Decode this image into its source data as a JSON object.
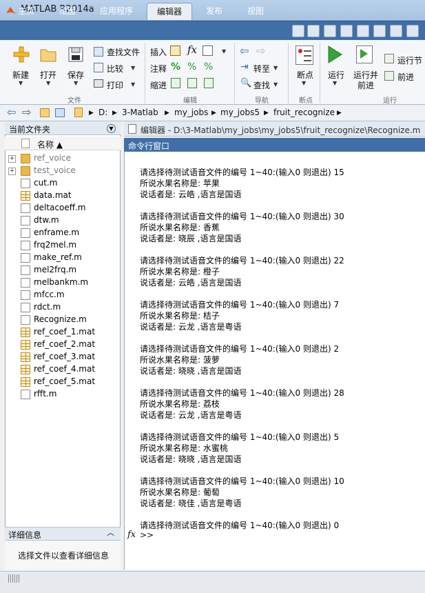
{
  "window": {
    "title": "MATLAB R2014a"
  },
  "tabs": [
    "主页",
    "绘图",
    "应用程序",
    "编辑器",
    "发布",
    "视图"
  ],
  "ribbon": {
    "file_group": {
      "new": "新建",
      "open": "打开",
      "save": "保存",
      "find_files": "查找文件",
      "compare": "比较",
      "print": "打印",
      "label": "文件"
    },
    "edit_group": {
      "insert": "插入",
      "comment": "注释",
      "indent": "缩进",
      "label": "编辑"
    },
    "nav_group": {
      "goto": "转至",
      "find": "查找",
      "label": "导航"
    },
    "breakpoint_group": {
      "breakpoints": "断点",
      "label": "断点"
    },
    "run_group": {
      "run": "运行",
      "run_advance_line1": "运行并",
      "run_advance_line2": "前进",
      "run_section": "运行节",
      "advance": "前进",
      "label": "运行"
    }
  },
  "address": {
    "crumbs": [
      "D:",
      "3-Matlab",
      "my_jobs",
      "my_jobs5",
      "fruit_recognize"
    ]
  },
  "left_panel": {
    "title": "当前文件夹",
    "column_name": "名称 ▲",
    "files": [
      {
        "name": "ref_voice",
        "type": "folder"
      },
      {
        "name": "test_voice",
        "type": "folder"
      },
      {
        "name": "cut.m",
        "type": "m"
      },
      {
        "name": "data.mat",
        "type": "mat"
      },
      {
        "name": "deltacoeff.m",
        "type": "m"
      },
      {
        "name": "dtw.m",
        "type": "m"
      },
      {
        "name": "enframe.m",
        "type": "m"
      },
      {
        "name": "frq2mel.m",
        "type": "m"
      },
      {
        "name": "make_ref.m",
        "type": "m"
      },
      {
        "name": "mel2frq.m",
        "type": "m"
      },
      {
        "name": "melbankm.m",
        "type": "m"
      },
      {
        "name": "mfcc.m",
        "type": "m"
      },
      {
        "name": "rdct.m",
        "type": "m"
      },
      {
        "name": "Recognize.m",
        "type": "m"
      },
      {
        "name": "ref_coef_1.mat",
        "type": "mat"
      },
      {
        "name": "ref_coef_2.mat",
        "type": "mat"
      },
      {
        "name": "ref_coef_3.mat",
        "type": "mat"
      },
      {
        "name": "ref_coef_4.mat",
        "type": "mat"
      },
      {
        "name": "ref_coef_5.mat",
        "type": "mat"
      },
      {
        "name": "rfft.m",
        "type": "m"
      }
    ],
    "details_title": "详细信息",
    "details_text": "选择文件以查看详细信息"
  },
  "editor": {
    "tab_title": "编辑器 - D:\\3-Matlab\\my_jobs\\my_jobs5\\fruit_recognize\\Recognize.m"
  },
  "command_window": {
    "title": "命令行窗口",
    "lines": [
      "请选择待测试语音文件的编号 1~40:(输入0 则退出) 15",
      "所说水果名称是: 苹果",
      "说话者是: 云皓 ,语言是国语",
      "请选择待测试语音文件的编号 1~40:(输入0 则退出) 30",
      "所说水果名称是: 香蕉",
      "说话者是: 晓辰 ,语言是国语",
      "请选择待测试语音文件的编号 1~40:(输入0 则退出) 22",
      "所说水果名称是: 橙子",
      "说话者是: 云皓 ,语言是国语",
      "请选择待测试语音文件的编号 1~40:(输入0 则退出) 7",
      "所说水果名称是: 桔子",
      "说话者是: 云龙 ,语言是粤语",
      "请选择待测试语音文件的编号 1~40:(输入0 则退出) 2",
      "所说水果名称是: 菠萝",
      "说话者是: 晓晓 ,语言是国语",
      "请选择待测试语音文件的编号 1~40:(输入0 则退出) 28",
      "所说水果名称是: 荔枝",
      "说话者是: 云龙 ,语言是粤语",
      "请选择待测试语音文件的编号 1~40:(输入0 则退出) 5",
      "所说水果名称是: 水蜜桃",
      "说话者是: 晓晓 ,语言是国语",
      "请选择待测试语音文件的编号 1~40:(输入0 则退出) 10",
      "所说水果名称是: 葡萄",
      "说话者是: 晓佳 ,语言是粤语",
      "请选择待测试语音文件的编号 1~40:(输入0 则退出) 0"
    ],
    "prompt": ">>",
    "fx": "fx"
  }
}
